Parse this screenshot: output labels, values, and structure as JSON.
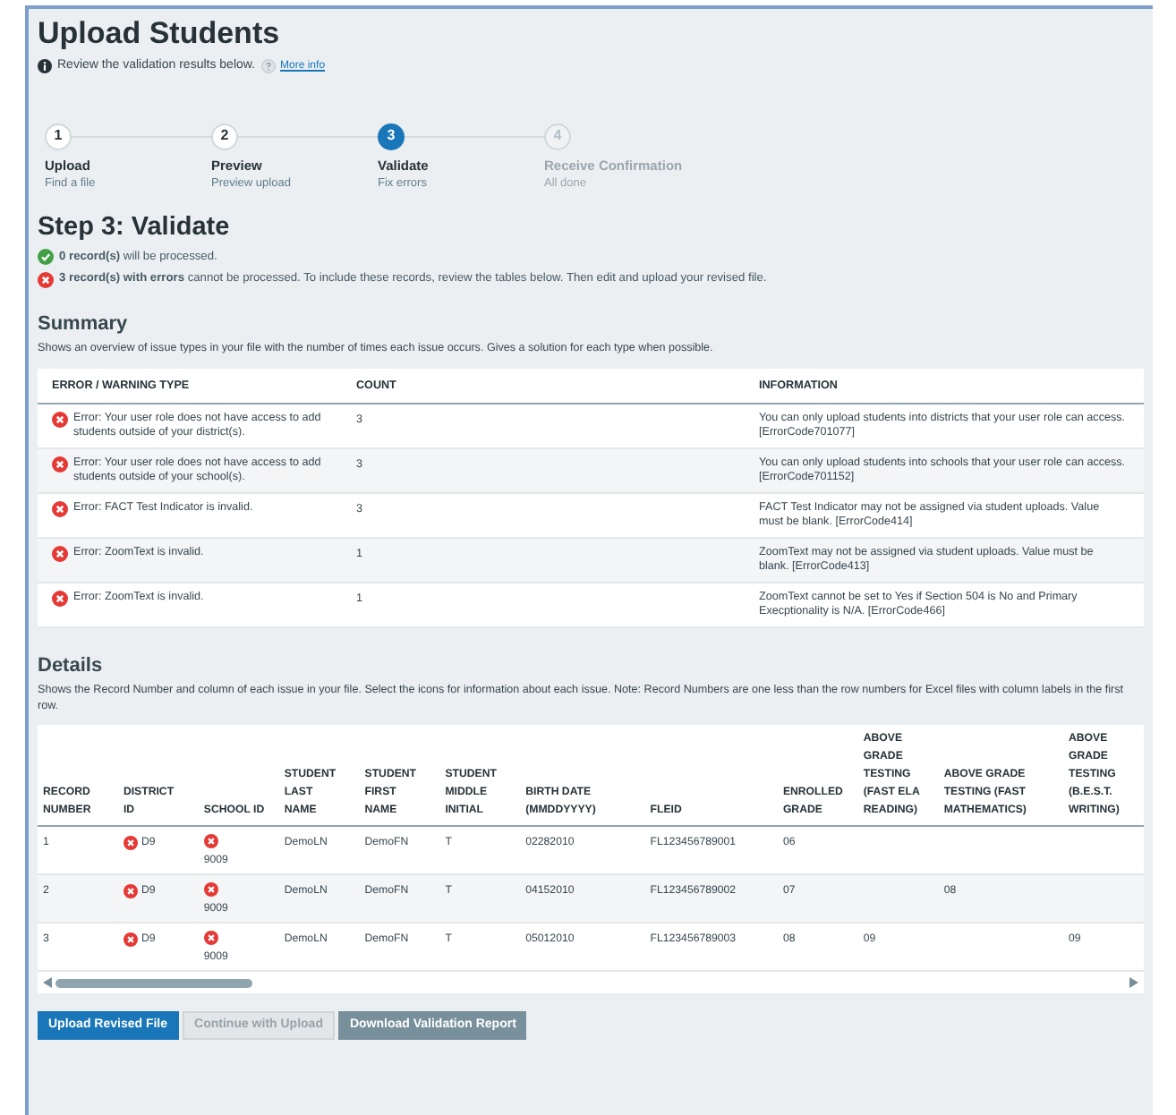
{
  "title": "Upload Students",
  "intro": {
    "text": "Review the validation results below.",
    "link": "More info"
  },
  "steps": [
    {
      "number": "1",
      "label": "Upload",
      "sub": "Find a file",
      "kind": "done"
    },
    {
      "number": "2",
      "label": "Preview",
      "sub": "Preview upload",
      "kind": "done"
    },
    {
      "number": "3",
      "label": "Validate",
      "sub": "Fix errors",
      "kind": "current"
    },
    {
      "number": "4",
      "label": "Receive Confirmation",
      "sub": "All done",
      "kind": "upcoming"
    }
  ],
  "step_heading": "Step 3: Validate",
  "results": [
    {
      "kind": "ok",
      "text": "**0 record(s)** will be processed."
    },
    {
      "kind": "error",
      "text": "**3 record(s) with errors** cannot be processed. To include these records, review the tables below. Then edit and upload your revised file."
    }
  ],
  "summary": {
    "heading": "Summary",
    "description": "Shows an overview of issue types in your file with the number of times each issue occurs. Gives a solution for each type when possible.",
    "columns": [
      "ERROR / WARNING TYPE",
      "COUNT",
      "INFORMATION"
    ],
    "rows": [
      {
        "type": "Error: Your user role does not have access to add students outside of your district(s).",
        "count": "3",
        "info": "You can only upload students into districts that your user role can access. [ErrorCode701077]"
      },
      {
        "type": "Error: Your user role does not have access to add students outside of your school(s).",
        "count": "3",
        "info": "You can only upload students into schools that your user role can access. [ErrorCode701152]"
      },
      {
        "type": "Error: FACT Test Indicator is invalid.",
        "count": "3",
        "info": "FACT Test Indicator may not be assigned via student uploads. Value must be blank. [ErrorCode414]"
      },
      {
        "type": "Error: ZoomText is invalid.",
        "count": "1",
        "info": "ZoomText may not be assigned via student uploads. Value must be blank. [ErrorCode413]"
      },
      {
        "type": "Error: ZoomText is invalid.",
        "count": "1",
        "info": "ZoomText cannot be set to Yes if Section 504 is No and Primary Execptionality is N/A. [ErrorCode466]"
      }
    ]
  },
  "details": {
    "heading": "Details",
    "description": "Shows the Record Number and column of each issue in your file. Select the icons for information about each issue. Note: Record Numbers are one less than the row numbers for Excel files with column labels in the first row.",
    "columns": [
      "RECORD NUMBER",
      "DISTRICT ID",
      "SCHOOL ID",
      "STUDENT LAST NAME",
      "STUDENT FIRST NAME",
      "STUDENT MIDDLE INITIAL",
      "BIRTH DATE (MMDDYYYY)",
      "FLEID",
      "ENROLLED GRADE",
      "ABOVE GRADE TESTING (FAST ELA READING)",
      "ABOVE GRADE TESTING (FAST MATHEMATICS)",
      "ABOVE GRADE TESTING (B.E.S.T. WRITING)"
    ],
    "rows": [
      {
        "record": "1",
        "district": "D9",
        "district_error": true,
        "school": "9009",
        "school_error": true,
        "last_name": "DemoLN",
        "first_name": "DemoFN",
        "middle_initial": "T",
        "birth_date": "02282010",
        "fleid": "FL123456789001",
        "grade": "06"
      },
      {
        "record": "2",
        "district": "D9",
        "district_error": true,
        "school": "9009",
        "school_error": true,
        "last_name": "DemoLN",
        "first_name": "DemoFN",
        "middle_initial": "T",
        "birth_date": "04152010",
        "fleid": "FL123456789002",
        "grade": "07",
        "fast_math": "08"
      },
      {
        "record": "3",
        "district": "D9",
        "district_error": true,
        "school": "9009",
        "school_error": true,
        "last_name": "DemoLN",
        "first_name": "DemoFN",
        "middle_initial": "T",
        "birth_date": "05012010",
        "fleid": "FL123456789003",
        "grade": "08",
        "fast_ela": "09",
        "best_writing": "09"
      }
    ]
  },
  "buttons": [
    {
      "label": "Upload Revised File",
      "kind": "primary",
      "disabled": false
    },
    {
      "label": "Continue with Upload",
      "kind": "primary",
      "disabled": true
    },
    {
      "label": "Download Validation Report",
      "kind": "secondary",
      "disabled": false
    }
  ]
}
